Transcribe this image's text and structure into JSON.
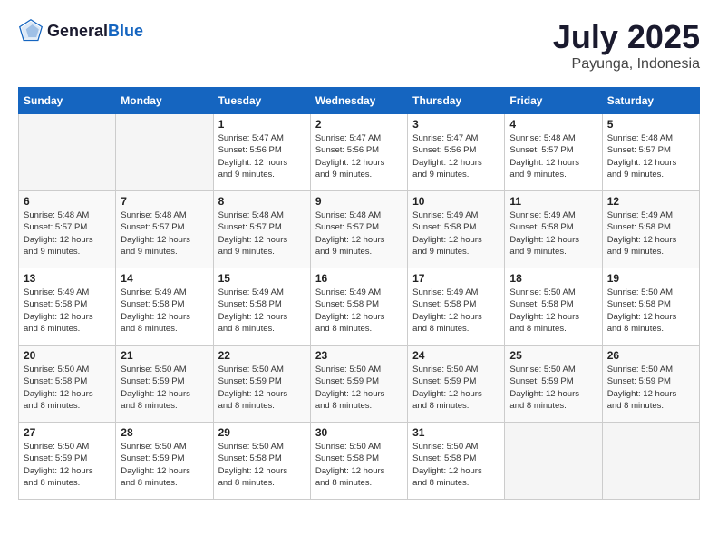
{
  "header": {
    "logo_general": "General",
    "logo_blue": "Blue",
    "month_title": "July 2025",
    "location": "Payunga, Indonesia"
  },
  "weekdays": [
    "Sunday",
    "Monday",
    "Tuesday",
    "Wednesday",
    "Thursday",
    "Friday",
    "Saturday"
  ],
  "weeks": [
    [
      {
        "day": "",
        "info": ""
      },
      {
        "day": "",
        "info": ""
      },
      {
        "day": "1",
        "info": "Sunrise: 5:47 AM\nSunset: 5:56 PM\nDaylight: 12 hours\nand 9 minutes."
      },
      {
        "day": "2",
        "info": "Sunrise: 5:47 AM\nSunset: 5:56 PM\nDaylight: 12 hours\nand 9 minutes."
      },
      {
        "day": "3",
        "info": "Sunrise: 5:47 AM\nSunset: 5:56 PM\nDaylight: 12 hours\nand 9 minutes."
      },
      {
        "day": "4",
        "info": "Sunrise: 5:48 AM\nSunset: 5:57 PM\nDaylight: 12 hours\nand 9 minutes."
      },
      {
        "day": "5",
        "info": "Sunrise: 5:48 AM\nSunset: 5:57 PM\nDaylight: 12 hours\nand 9 minutes."
      }
    ],
    [
      {
        "day": "6",
        "info": "Sunrise: 5:48 AM\nSunset: 5:57 PM\nDaylight: 12 hours\nand 9 minutes."
      },
      {
        "day": "7",
        "info": "Sunrise: 5:48 AM\nSunset: 5:57 PM\nDaylight: 12 hours\nand 9 minutes."
      },
      {
        "day": "8",
        "info": "Sunrise: 5:48 AM\nSunset: 5:57 PM\nDaylight: 12 hours\nand 9 minutes."
      },
      {
        "day": "9",
        "info": "Sunrise: 5:48 AM\nSunset: 5:57 PM\nDaylight: 12 hours\nand 9 minutes."
      },
      {
        "day": "10",
        "info": "Sunrise: 5:49 AM\nSunset: 5:58 PM\nDaylight: 12 hours\nand 9 minutes."
      },
      {
        "day": "11",
        "info": "Sunrise: 5:49 AM\nSunset: 5:58 PM\nDaylight: 12 hours\nand 9 minutes."
      },
      {
        "day": "12",
        "info": "Sunrise: 5:49 AM\nSunset: 5:58 PM\nDaylight: 12 hours\nand 9 minutes."
      }
    ],
    [
      {
        "day": "13",
        "info": "Sunrise: 5:49 AM\nSunset: 5:58 PM\nDaylight: 12 hours\nand 8 minutes."
      },
      {
        "day": "14",
        "info": "Sunrise: 5:49 AM\nSunset: 5:58 PM\nDaylight: 12 hours\nand 8 minutes."
      },
      {
        "day": "15",
        "info": "Sunrise: 5:49 AM\nSunset: 5:58 PM\nDaylight: 12 hours\nand 8 minutes."
      },
      {
        "day": "16",
        "info": "Sunrise: 5:49 AM\nSunset: 5:58 PM\nDaylight: 12 hours\nand 8 minutes."
      },
      {
        "day": "17",
        "info": "Sunrise: 5:49 AM\nSunset: 5:58 PM\nDaylight: 12 hours\nand 8 minutes."
      },
      {
        "day": "18",
        "info": "Sunrise: 5:50 AM\nSunset: 5:58 PM\nDaylight: 12 hours\nand 8 minutes."
      },
      {
        "day": "19",
        "info": "Sunrise: 5:50 AM\nSunset: 5:58 PM\nDaylight: 12 hours\nand 8 minutes."
      }
    ],
    [
      {
        "day": "20",
        "info": "Sunrise: 5:50 AM\nSunset: 5:58 PM\nDaylight: 12 hours\nand 8 minutes."
      },
      {
        "day": "21",
        "info": "Sunrise: 5:50 AM\nSunset: 5:59 PM\nDaylight: 12 hours\nand 8 minutes."
      },
      {
        "day": "22",
        "info": "Sunrise: 5:50 AM\nSunset: 5:59 PM\nDaylight: 12 hours\nand 8 minutes."
      },
      {
        "day": "23",
        "info": "Sunrise: 5:50 AM\nSunset: 5:59 PM\nDaylight: 12 hours\nand 8 minutes."
      },
      {
        "day": "24",
        "info": "Sunrise: 5:50 AM\nSunset: 5:59 PM\nDaylight: 12 hours\nand 8 minutes."
      },
      {
        "day": "25",
        "info": "Sunrise: 5:50 AM\nSunset: 5:59 PM\nDaylight: 12 hours\nand 8 minutes."
      },
      {
        "day": "26",
        "info": "Sunrise: 5:50 AM\nSunset: 5:59 PM\nDaylight: 12 hours\nand 8 minutes."
      }
    ],
    [
      {
        "day": "27",
        "info": "Sunrise: 5:50 AM\nSunset: 5:59 PM\nDaylight: 12 hours\nand 8 minutes."
      },
      {
        "day": "28",
        "info": "Sunrise: 5:50 AM\nSunset: 5:59 PM\nDaylight: 12 hours\nand 8 minutes."
      },
      {
        "day": "29",
        "info": "Sunrise: 5:50 AM\nSunset: 5:58 PM\nDaylight: 12 hours\nand 8 minutes."
      },
      {
        "day": "30",
        "info": "Sunrise: 5:50 AM\nSunset: 5:58 PM\nDaylight: 12 hours\nand 8 minutes."
      },
      {
        "day": "31",
        "info": "Sunrise: 5:50 AM\nSunset: 5:58 PM\nDaylight: 12 hours\nand 8 minutes."
      },
      {
        "day": "",
        "info": ""
      },
      {
        "day": "",
        "info": ""
      }
    ]
  ]
}
